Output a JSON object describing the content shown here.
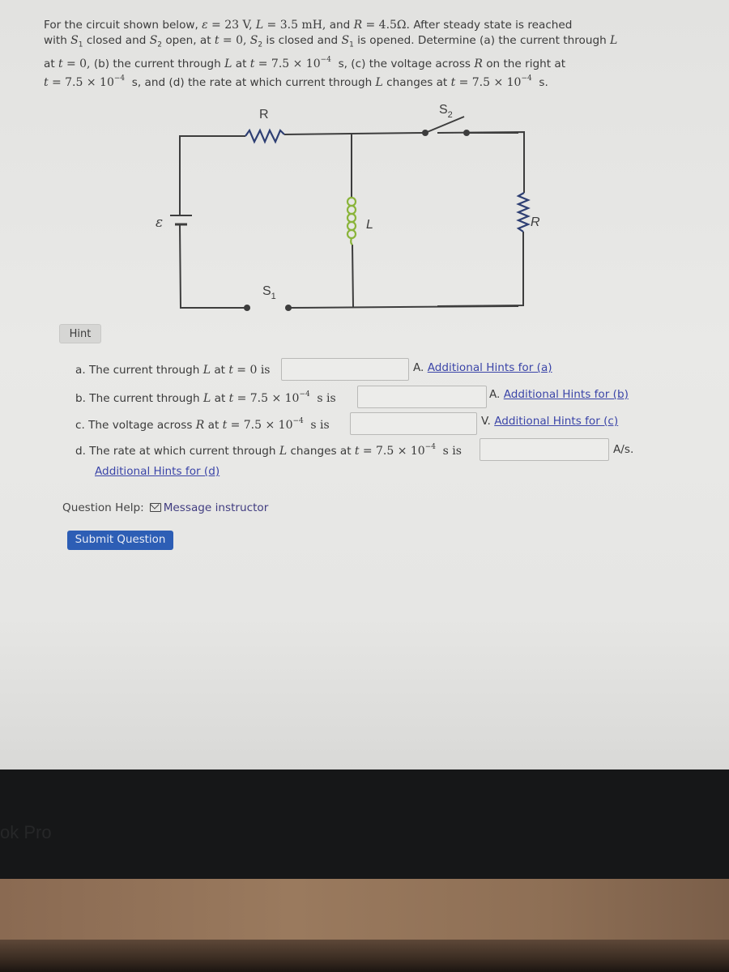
{
  "problem": {
    "intro": "For the circuit shown below,",
    "emf_symbol": "ε",
    "emf_value": "= 23  V,",
    "L_symbol": "L",
    "L_value": "= 3.5  mH,",
    "and": "and",
    "R_symbol": "R",
    "R_value": "= 4.5Ω.",
    "after": "After steady state is reached",
    "line2_a": "with",
    "S1": "S",
    "S1_sub": "1",
    "line2_b": "closed and",
    "S2": "S",
    "S2_sub": "2",
    "line2_c": "open, at",
    "t": "t",
    "eq0": "= 0,",
    "line2_d": "is closed and",
    "line2_e": "is opened. Determine (a) the current through",
    "line3_a": "at",
    "line3_b": "(b) the current through",
    "line3_c": "at",
    "time_value": "= 7.5 × 10",
    "exp": "−4",
    "line3_d": "s, (c) the voltage across",
    "line3_e": "on the right at",
    "line4_a": "s, and (d) the rate at which current through",
    "line4_b": "changes at",
    "line4_c": "s."
  },
  "circuit": {
    "label_R_top": "R",
    "label_S2": "S",
    "label_S2_sub": "2",
    "label_emf": "ε",
    "label_L": "L",
    "label_R_right": "R",
    "label_S1": "S",
    "label_S1_sub": "1",
    "colors": {
      "wire": "#3d3d3d",
      "resistor": "#2e3f73",
      "inductor": "#8ab43a"
    }
  },
  "hint_button": "Hint",
  "questions": [
    {
      "prefix": "a. The current through",
      "var": "L",
      "mid": "at",
      "t": "t",
      "cond": "= 0 is",
      "input_value": "",
      "hint_prefix": "A.",
      "hint_link": "Additional Hints for (a)"
    },
    {
      "prefix": "b. The current through",
      "var": "L",
      "mid": "at",
      "t": "t",
      "cond": "= 7.5 × 10",
      "exp": "−4",
      "suffix": "s is",
      "input_value": "",
      "hint_prefix": "A.",
      "hint_link": "Additional Hints for (b)"
    },
    {
      "prefix": "c. The voltage across",
      "var": "R",
      "mid": "at",
      "t": "t",
      "cond": "= 7.5 × 10",
      "exp": "−4",
      "suffix": "s is",
      "input_value": "",
      "hint_prefix": "V.",
      "hint_link": "Additional Hints for (c)"
    },
    {
      "prefix": "d. The rate at which current through",
      "var": "L",
      "mid": "changes at",
      "t": "t",
      "cond": "= 7.5 × 10",
      "exp": "−4",
      "suffix": "s is",
      "input_value": "",
      "unit": "A/s.",
      "hint_link": "Additional Hints for (d)"
    }
  ],
  "help": {
    "label": "Question Help:",
    "message_link": "Message instructor",
    "icon": "mail-icon"
  },
  "submit_button": "Submit Question",
  "bezel_text": "ok Pro"
}
